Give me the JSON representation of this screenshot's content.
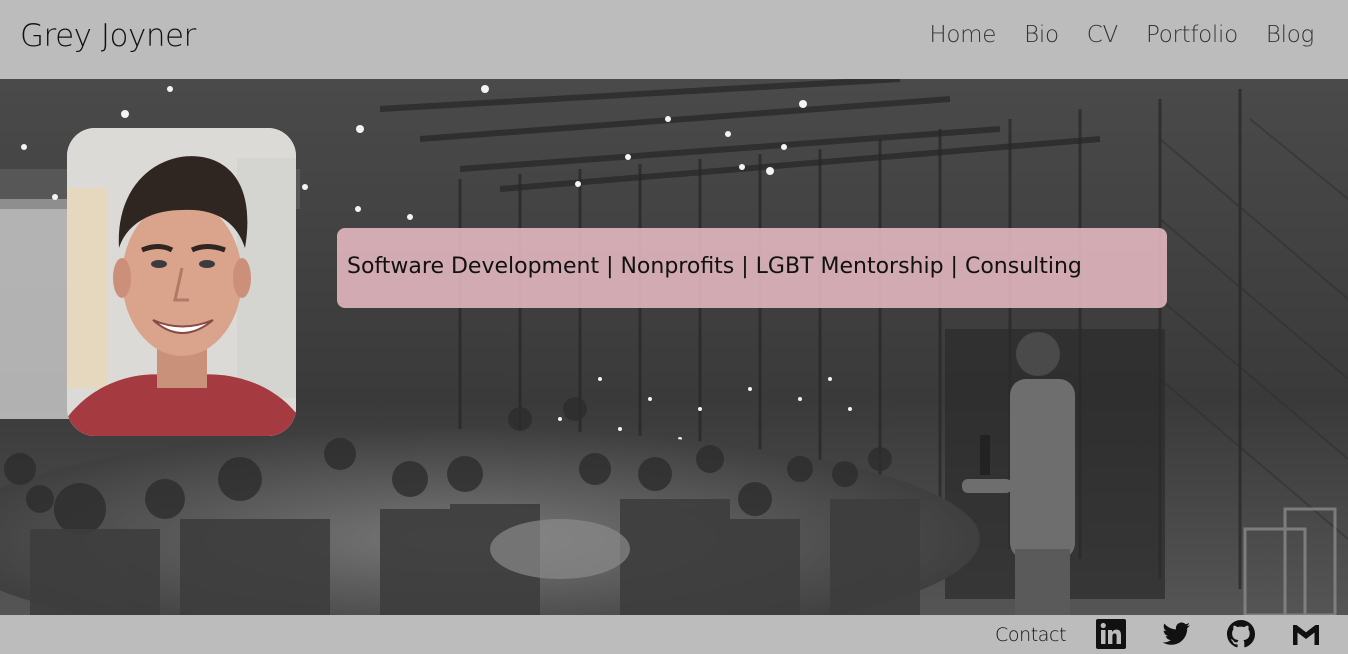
{
  "header": {
    "site_title": "Grey Joyner",
    "nav": [
      {
        "label": "Home"
      },
      {
        "label": "Bio"
      },
      {
        "label": "CV"
      },
      {
        "label": "Portfolio"
      },
      {
        "label": "Blog"
      }
    ]
  },
  "hero": {
    "background": "black-and-white photo of a speaker with microphone addressing seated guests in a barn venue",
    "portrait": "headshot of smiling man",
    "tagline": "Software Development | Nonprofits | LGBT Mentorship | Consulting",
    "tagline_bg": "#ecbec7"
  },
  "footer": {
    "contact_label": "Contact",
    "social_icons": [
      "linkedin-icon",
      "twitter-icon",
      "github-icon",
      "gmail-icon"
    ]
  },
  "colors": {
    "bar_bg": "#bcbcbc",
    "text": "#111111"
  }
}
